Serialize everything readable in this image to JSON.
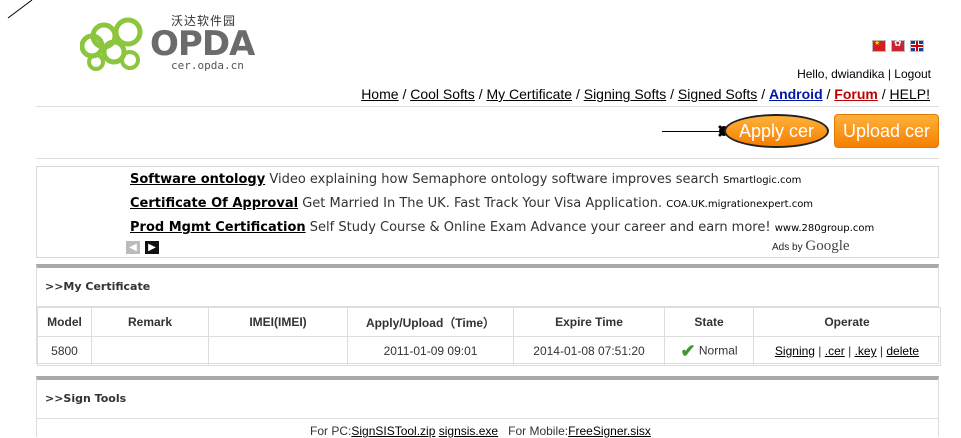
{
  "logo": {
    "cn_text": "沃达软件园",
    "word": "OPDA",
    "domain": "cer.opda.cn"
  },
  "flags": [
    "china-flag-icon",
    "taiwan-flag-icon",
    "uk-flag-icon"
  ],
  "user": {
    "greeting": "Hello, dwiandika",
    "separator": "|",
    "logout": "Logout"
  },
  "nav": {
    "items": [
      "Home",
      "Cool Softs",
      "My Certificate",
      "Signing Softs",
      "Signed Softs",
      "Android",
      "Forum",
      "HELP!"
    ],
    "separator": "/"
  },
  "actions": {
    "apply": "Apply cer",
    "upload": "Upload cer"
  },
  "ads": {
    "items": [
      {
        "title": "Software ontology",
        "text": "Video explaining how Semaphore ontology software improves search",
        "url": "Smartlogic.com"
      },
      {
        "title": "Certificate Of Approval",
        "text": "Get Married In The UK. Fast Track Your Visa Application.",
        "url": "COA.UK.migrationexpert.com"
      },
      {
        "title": "Prod Mgmt Certification",
        "text": "Self Study Course & Online Exam Advance your career and earn more!",
        "url": "www.280group.com"
      }
    ],
    "ads_by": "Ads by",
    "google": "Google"
  },
  "my_certificate": {
    "title": ">>My Certificate",
    "columns": [
      "Model",
      "Remark",
      "IMEI(IMEI)",
      "Apply/Upload（Time）",
      "Expire Time",
      "State",
      "Operate"
    ],
    "rows": [
      {
        "model": "5800",
        "remark": "",
        "imei": "",
        "apply_time": "2011-01-09 09:01",
        "expire_time": "2014-01-08 07:51:20",
        "state": "Normal",
        "ops": [
          "Signing",
          ".cer",
          ".key",
          "delete"
        ]
      }
    ]
  },
  "sign_tools": {
    "title": ">>Sign Tools",
    "pc_label": "For PC:",
    "pc_link1": "SignSISTool.zip",
    "pc_link2": "signsis.exe",
    "mobile_label": "For Mobile:",
    "mobile_link": "FreeSigner.sisx"
  }
}
